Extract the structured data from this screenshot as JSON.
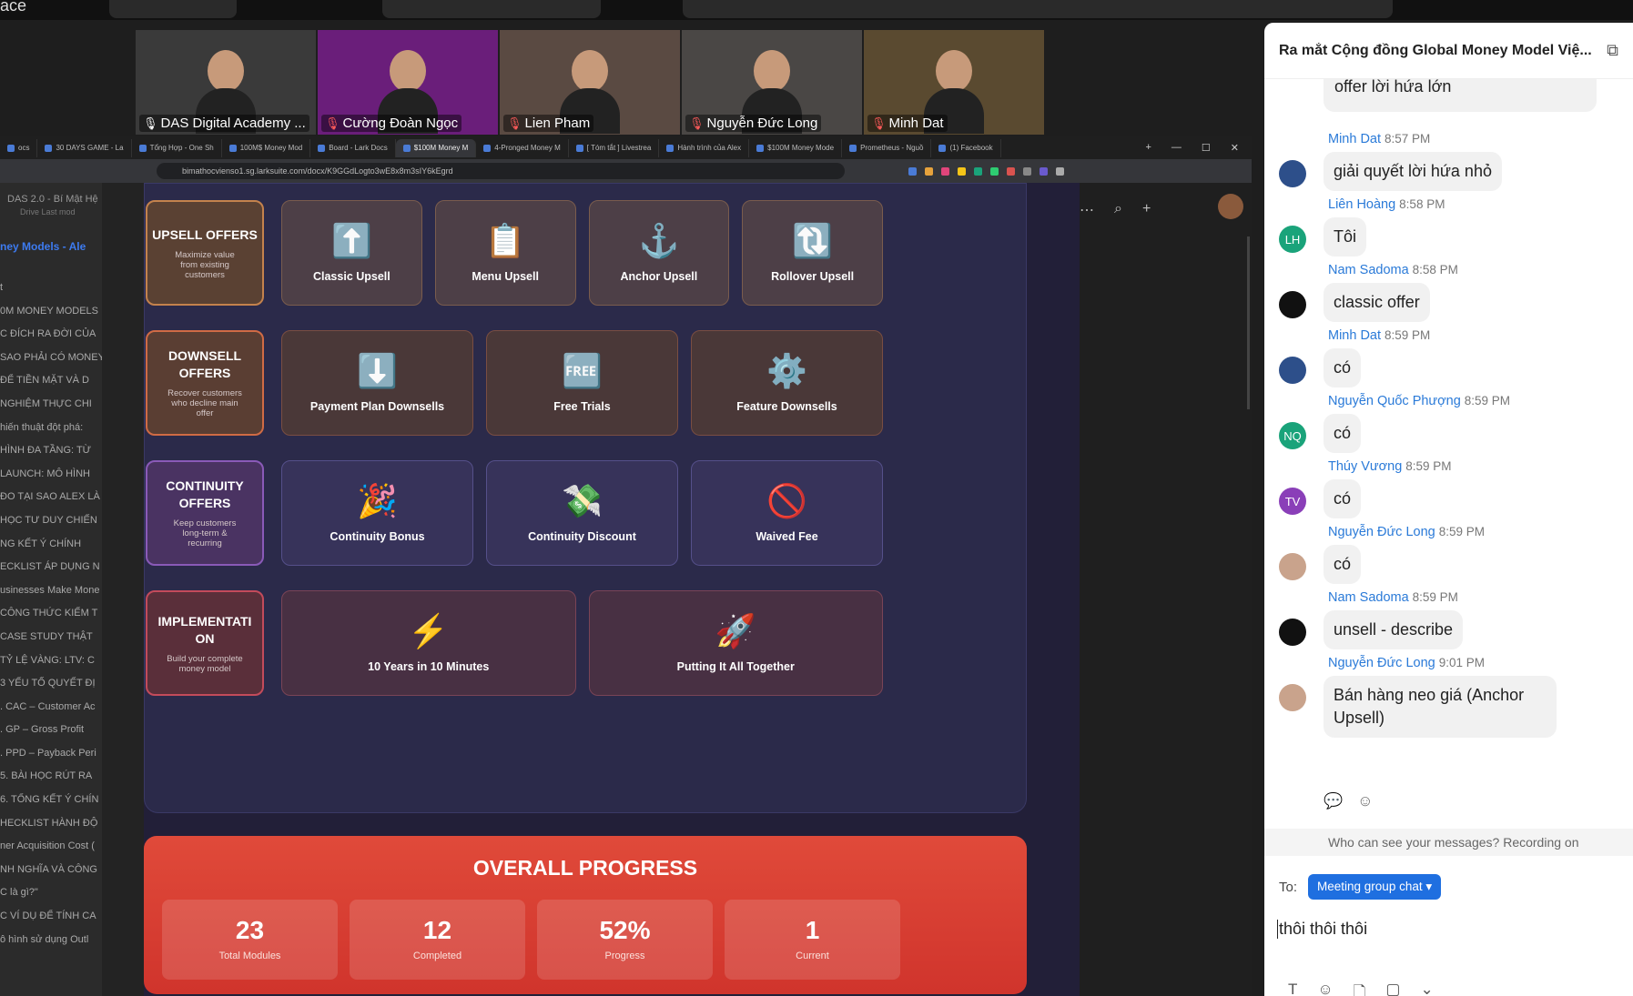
{
  "top": {
    "app_fragment": "ace"
  },
  "participants": [
    {
      "name": "DAS Digital Academy ...",
      "active": true,
      "muted": false,
      "bg": "#3a3a3a"
    },
    {
      "name": "Cường Đoàn Ngọc",
      "active": false,
      "muted": true,
      "bg": "#6a1e7a"
    },
    {
      "name": "Lien Pham",
      "active": false,
      "muted": true,
      "bg": "#5a4a42"
    },
    {
      "name": "Nguyễn Đức Long",
      "active": false,
      "muted": true,
      "bg": "#4a4745"
    },
    {
      "name": "Minh Dat",
      "active": false,
      "muted": true,
      "bg": "#5a4a30"
    }
  ],
  "browser": {
    "tabs": [
      "ocs",
      "30 DAYS GAME - La",
      "Tổng Hợp - One Sh",
      "100M$ Money Mod",
      "Board - Lark Docs",
      "$100M Money M",
      "4-Pronged Money M",
      "[ Tóm tắt ] Livestrea",
      "Hành trình của Alex",
      "$100M Money Mode",
      "Prometheus - Nguồ",
      "(1) Facebook"
    ],
    "active_tab": "$100M Money M",
    "url": "bimathocvienso1.sg.larksuite.com/docx/K9GGdLogto3wE8x8m3sIY6kEgrd"
  },
  "doc_sidebar": {
    "crumb": "DAS 2.0 - Bí Mật Hệ",
    "crumb_sub": "Drive    Last mod",
    "toc_title": "ney Models - Ale",
    "items": [
      "t",
      "0M MONEY MODELS",
      "C ĐÍCH RA ĐỜI CỦA",
      "SAO PHẢI CÓ MONEY",
      "ĐỂ TIỀN MẶT VÀ D",
      "NGHIỆM THỰC CHI",
      "hiến thuật đột phá:",
      "HÌNH ĐA TẦNG: TỪ",
      "LAUNCH: MÔ HÌNH",
      "ĐO TẠI SAO ALEX LÀ",
      "HỌC TƯ DUY CHIẾN",
      "NG KẾT Ý CHÍNH",
      "ECKLIST ÁP DỤNG N",
      "usinesses Make Mone",
      "CÔNG THỨC KIẾM T",
      "CASE STUDY THẬT",
      "TỶ LỆ VÀNG: LTV: C",
      "3 YẾU TỐ QUYẾT ĐỊ",
      ". CAC – Customer Ac",
      ". GP – Gross Profit",
      ". PPD – Payback Peri",
      "5. BÀI HỌC RÚT RA",
      "6. TỔNG KẾT Ý CHÍN",
      "HECKLIST HÀNH ĐỘ",
      "ner Acquisition Cost (",
      "NH NGHĨA VÀ CÔNG",
      "C là gì?\"",
      "C VÍ DỤ ĐỂ TÍNH CA",
      "ô hình sử dụng Outl"
    ]
  },
  "slide": {
    "upsell": {
      "title": "UPSELL OFFERS",
      "subtitle": "Maximize value from existing customers",
      "items": [
        {
          "icon": "⬆️",
          "label": "Classic Upsell"
        },
        {
          "icon": "📋",
          "label": "Menu Upsell"
        },
        {
          "icon": "⚓",
          "label": "Anchor Upsell"
        },
        {
          "icon": "🔃",
          "label": "Rollover Upsell"
        }
      ]
    },
    "downsell": {
      "title": "DOWNSELL OFFERS",
      "subtitle": "Recover customers who decline main offer",
      "items": [
        {
          "icon": "⬇️",
          "label": "Payment Plan Downsells"
        },
        {
          "icon": "🆓",
          "label": "Free Trials"
        },
        {
          "icon": "⚙️",
          "label": "Feature Downsells"
        }
      ]
    },
    "continuity": {
      "title": "CONTINUITY OFFERS",
      "subtitle": "Keep customers long-term & recurring",
      "items": [
        {
          "icon": "🎉",
          "label": "Continuity Bonus"
        },
        {
          "icon": "💸",
          "label": "Continuity Discount"
        },
        {
          "icon": "🚫",
          "label": "Waived Fee"
        }
      ]
    },
    "implementation": {
      "title": "IMPLEMENTATI ON",
      "subtitle": "Build your complete money model",
      "items": [
        {
          "icon": "⚡",
          "label": "10 Years in 10 Minutes"
        },
        {
          "icon": "🚀",
          "label": "Putting It All Together"
        }
      ]
    },
    "progress": {
      "title": "OVERALL PROGRESS",
      "stats": [
        {
          "value": "23",
          "label": "Total Modules"
        },
        {
          "value": "12",
          "label": "Completed"
        },
        {
          "value": "52%",
          "label": "Progress"
        },
        {
          "value": "1",
          "label": "Current"
        }
      ]
    }
  },
  "chat": {
    "title": "Ra mắt Cộng đồng Global Money Model Việ...",
    "top_fragment": "offer lời hứa lớn",
    "messages": [
      {
        "name": "Minh Dat",
        "time": "8:57 PM",
        "text": "giải quyết lời hứa nhỏ",
        "avatar": "",
        "avatar_color": "#2d4f8a"
      },
      {
        "name": "Liên Hoàng",
        "time": "8:58 PM",
        "text": "Tôi",
        "avatar": "LH",
        "avatar_color": "#1aa37a"
      },
      {
        "name": "Nam Sadoma",
        "time": "8:58 PM",
        "text": "classic offer",
        "avatar": "",
        "avatar_color": "#111111"
      },
      {
        "name": "Minh Dat",
        "time": "8:59 PM",
        "text": "có",
        "avatar": "",
        "avatar_color": "#2d4f8a"
      },
      {
        "name": "Nguyễn Quốc Phượng",
        "time": "8:59 PM",
        "text": "có",
        "avatar": "NQ",
        "avatar_color": "#1aa37a"
      },
      {
        "name": "Thúy Vương",
        "time": "8:59 PM",
        "text": "có",
        "avatar": "TV",
        "avatar_color": "#8a3fb8"
      },
      {
        "name": "Nguyễn Đức Long",
        "time": "8:59 PM",
        "text": "có",
        "avatar": "",
        "avatar_color": "#c9a38c"
      },
      {
        "name": "Nam Sadoma",
        "time": "8:59 PM",
        "text": "unsell - describe",
        "avatar": "",
        "avatar_color": "#111111"
      },
      {
        "name": "Nguyễn Đức Long",
        "time": "9:01 PM",
        "text": "Bán hàng neo giá (Anchor Upsell)",
        "avatar": "",
        "avatar_color": "#c9a38c"
      }
    ],
    "notice": "Who can see your messages? Recording on",
    "to_label": "To:",
    "recipient": "Meeting group chat",
    "draft": "thôi thôi thôi"
  }
}
